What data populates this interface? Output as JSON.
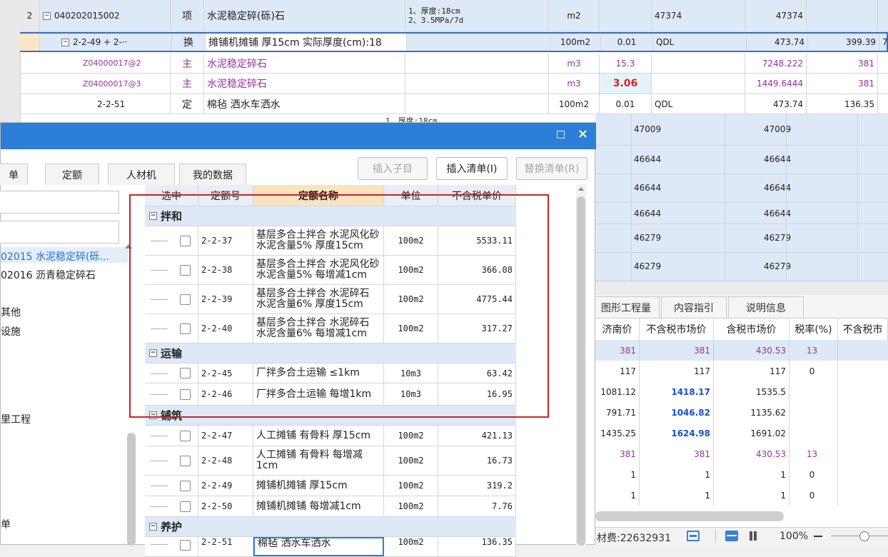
{
  "top_rows": [
    {
      "num": "2",
      "code": "040202015002",
      "type": "项",
      "name": "水泥稳定碎(砾)石",
      "feature": [
        "1、厚度:18cm",
        "2、3.5MPa/7d"
      ],
      "unit": "m2",
      "qty": "",
      "price": "47374",
      "total": "47374",
      "c9": "",
      "code_prefix": "−"
    },
    {
      "num": "",
      "code": "2-2-49 + 2-··",
      "type": "换",
      "name": "摊铺机摊铺 厚15cm  实际厚度(cm):18",
      "feature": [],
      "unit": "100m2",
      "qty": "0.01",
      "price": "QDL",
      "total": "473.74",
      "c9": "399.39",
      "c10": "7",
      "code_prefix": "−"
    },
    {
      "num": "",
      "code": "Z04000017@2",
      "type": "主",
      "name": "水泥稳定碎石",
      "feature": [],
      "unit": "m3",
      "qty": "15.3",
      "price": "",
      "total": "7248.222",
      "c9": "381"
    },
    {
      "num": "",
      "code": "Z04000017@3",
      "type": "主",
      "name": "水泥稳定碎石",
      "feature": [],
      "unit": "m3",
      "qty": "3.06",
      "price": "",
      "total": "1449.6444",
      "c9": "381"
    },
    {
      "num": "",
      "code": "2-2-51",
      "type": "定",
      "name": "棉毡 洒水车洒水",
      "feature": [],
      "unit": "100m2",
      "qty": "0.01",
      "price": "QDL",
      "total": "473.74",
      "c9": "136.35"
    }
  ],
  "bg_right_rows": [
    {
      "a": "47009",
      "b": "47009"
    },
    {
      "a": "46644",
      "b": "46644"
    },
    {
      "a": "46644",
      "b": "46644"
    },
    {
      "a": "46644",
      "b": "46644"
    },
    {
      "a": "46279",
      "b": "46279"
    },
    {
      "a": "46279",
      "b": "46279"
    }
  ],
  "bg_partial_feature": "1、厚度:18cm",
  "right_panel": {
    "tabs": [
      "图形工程量",
      "内容指引",
      "说明信息"
    ],
    "headers": [
      "济南价",
      "不含税市场价",
      "含税市场价",
      "税率(%)",
      "不含税市"
    ],
    "rows": [
      [
        "381",
        "381",
        "430.53",
        "13",
        ""
      ],
      [
        "117",
        "117",
        "117",
        "0",
        ""
      ],
      [
        "1081.12",
        "1418.17",
        "1535.5",
        "",
        ""
      ],
      [
        "791.71",
        "1046.82",
        "1135.62",
        "",
        ""
      ],
      [
        "1435.25",
        "1624.98",
        "1691.02",
        "",
        ""
      ],
      [
        "381",
        "381",
        "430.53",
        "13",
        ""
      ],
      [
        "1",
        "1",
        "1",
        "0",
        ""
      ],
      [
        "1",
        "1",
        "1",
        "0",
        ""
      ]
    ],
    "status_label": "材费:22632931",
    "zoom": "100%"
  },
  "dialog": {
    "title_buttons": {
      "maximize": "□",
      "close": "×"
    },
    "tabs": [
      "单",
      "定额",
      "人材机",
      "我的数据"
    ],
    "buttons": {
      "insert_child": "插入子目",
      "insert_list": "插入清单(I)",
      "replace_list": "替换清单(R)"
    },
    "left_tree": [
      "02015  水泥稳定碎(砾...",
      "02016  沥青稳定碎石",
      "其他",
      "设施",
      "里工程",
      "单"
    ],
    "table_headers": [
      "选中",
      "定额号",
      "定额名称",
      "单位",
      "不含税单价"
    ],
    "groups": [
      {
        "name": "拌和",
        "items": [
          {
            "code": "2-2-37",
            "name": "基层多合土拌合 水泥风化砂 水泥含量5% 厚度15cm",
            "unit": "100m2",
            "price": "5533.11"
          },
          {
            "code": "2-2-38",
            "name": "基层多合土拌合 水泥风化砂 水泥含量5% 每增减1cm",
            "unit": "100m2",
            "price": "366.08"
          },
          {
            "code": "2-2-39",
            "name": "基层多合土拌合 水泥碎石 水泥含量6% 厚度15cm",
            "unit": "100m2",
            "price": "4775.44"
          },
          {
            "code": "2-2-40",
            "name": "基层多合土拌合 水泥碎石 水泥含量6% 每增减1cm",
            "unit": "100m2",
            "price": "317.27"
          }
        ]
      },
      {
        "name": "运输",
        "items": [
          {
            "code": "2-2-45",
            "name": "厂拌多合土运输 ≤1km",
            "unit": "10m3",
            "price": "63.42"
          },
          {
            "code": "2-2-46",
            "name": "厂拌多合土运输 每增1km",
            "unit": "10m3",
            "price": "16.95"
          }
        ]
      },
      {
        "name": "铺筑",
        "items": [
          {
            "code": "2-2-47",
            "name": "人工摊铺 有骨料 厚15cm",
            "unit": "100m2",
            "price": "421.13"
          },
          {
            "code": "2-2-48",
            "name": "人工摊铺 有骨料 每增减1cm",
            "unit": "100m2",
            "price": "16.73"
          },
          {
            "code": "2-2-49",
            "name": "摊铺机摊铺 厚15cm",
            "unit": "100m2",
            "price": "319.2"
          },
          {
            "code": "2-2-50",
            "name": "摊铺机摊铺 每增减1cm",
            "unit": "100m2",
            "price": "7.76"
          }
        ]
      },
      {
        "name": "养护",
        "items": [
          {
            "code": "2-2-51",
            "name": "棉毡 洒水车洒水",
            "unit": "100m2",
            "price": "136.35"
          }
        ]
      }
    ]
  },
  "colors": {
    "title_blue": "#2b7fd6",
    "selection_red": "#cc2222",
    "row_blue": "#dde9f6",
    "purple": "#9b2fa4"
  }
}
